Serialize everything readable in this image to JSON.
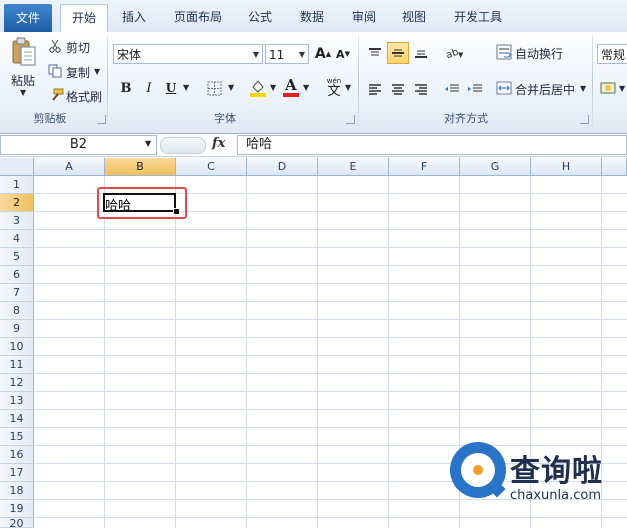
{
  "tabs": [
    {
      "label": "文件",
      "kind": "file"
    },
    {
      "label": "开始",
      "kind": "active"
    },
    {
      "label": "插入"
    },
    {
      "label": "页面布局"
    },
    {
      "label": "公式"
    },
    {
      "label": "数据"
    },
    {
      "label": "审阅"
    },
    {
      "label": "视图"
    },
    {
      "label": "开发工具"
    }
  ],
  "clipboard": {
    "paste": "粘贴",
    "cut": "剪切",
    "copy": "复制",
    "format_painter": "格式刷",
    "label": "剪贴板"
  },
  "font": {
    "name": "宋体",
    "size": "11",
    "label": "字体",
    "bold": "B",
    "italic": "I",
    "underline": "U",
    "grow": "A",
    "shrink": "A",
    "wen": "wén",
    "wen_char": "文"
  },
  "alignment": {
    "wrap": "自动换行",
    "merge": "合并后居中",
    "label": "对齐方式"
  },
  "number": {
    "format": "常规"
  },
  "formula_bar": {
    "name_box": "B2",
    "fx": "fx",
    "content": "哈哈"
  },
  "grid": {
    "columns": [
      "A",
      "B",
      "C",
      "D",
      "E",
      "F",
      "G",
      "H"
    ],
    "selected_column": "B",
    "rows": [
      "1",
      "2",
      "3",
      "4",
      "5",
      "6",
      "7",
      "8",
      "9",
      "10",
      "11",
      "12",
      "13",
      "14",
      "15",
      "16",
      "17",
      "18",
      "19",
      "20"
    ],
    "selected_row": "2",
    "active_cell_value": "哈哈"
  },
  "watermark": {
    "title": "查询啦",
    "domain": "chaxunla.com"
  },
  "colors": {
    "accent": "#1f5ea6",
    "selection": "#f1c15f",
    "highlight_box": "#e04a4a",
    "font_color": "#e02020",
    "fill_color": "#ffd800"
  }
}
